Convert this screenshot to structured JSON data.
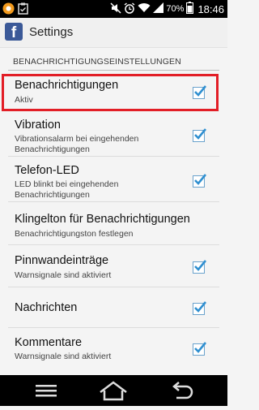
{
  "status_bar": {
    "battery_percent": "70%",
    "time": "18:46",
    "icons": [
      "orange-app-icon",
      "clipboard-icon",
      "mute-icon",
      "alarm-icon",
      "wifi-icon",
      "signal-icon",
      "battery-icon"
    ]
  },
  "action_bar": {
    "title": "Settings",
    "logo_letter": "f",
    "logo_color": "#3b5998"
  },
  "section": {
    "header": "BENACHRICHTIGUNGSEINSTELLUNGEN"
  },
  "settings": [
    {
      "title": "Benachrichtigungen",
      "subtitle": "Aktiv",
      "checked": true
    },
    {
      "title": "Vibration",
      "subtitle": "Vibrationsalarm bei eingehenden Benachrichtigungen",
      "checked": true
    },
    {
      "title": "Telefon-LED",
      "subtitle": "LED blinkt bei eingehenden Benachrichtigungen",
      "checked": true
    },
    {
      "title": "Klingelton für Benachrichtigungen",
      "subtitle": "Benachrichtigungston festlegen",
      "checked": false
    },
    {
      "title": "Pinnwandeinträge",
      "subtitle": "Warnsignale sind aktiviert",
      "checked": true
    },
    {
      "title": "Nachrichten",
      "subtitle": "",
      "checked": true
    },
    {
      "title": "Kommentare",
      "subtitle": "Warnsignale sind aktiviert",
      "checked": true
    }
  ],
  "colors": {
    "accent": "#e21e26",
    "checkbox_border": "#6aa2cc",
    "check": "#2f8fd0"
  }
}
